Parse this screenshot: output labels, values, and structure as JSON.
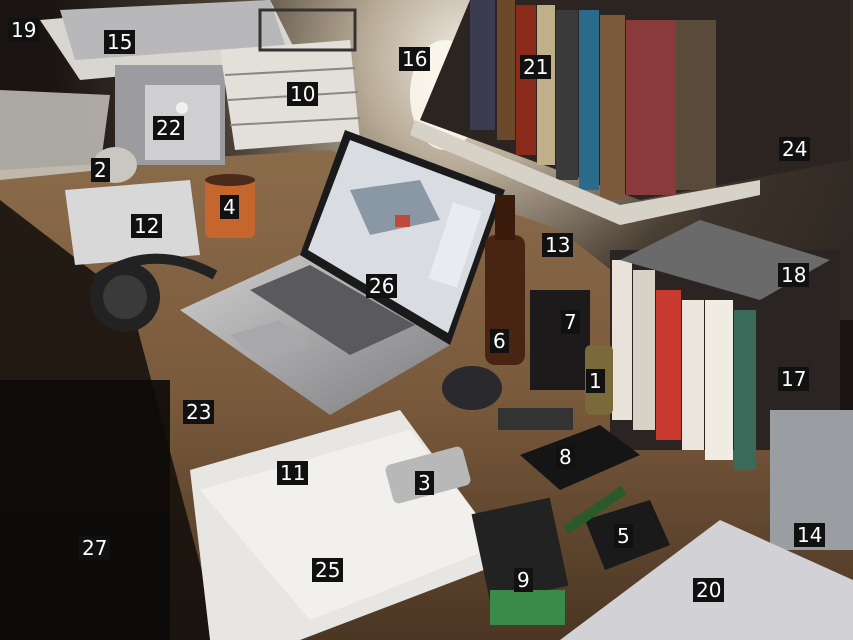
{
  "labels": [
    {
      "id": "l1",
      "text": "1"
    },
    {
      "id": "l2",
      "text": "2"
    },
    {
      "id": "l3",
      "text": "3"
    },
    {
      "id": "l4",
      "text": "4"
    },
    {
      "id": "l5",
      "text": "5"
    },
    {
      "id": "l6",
      "text": "6"
    },
    {
      "id": "l7",
      "text": "7"
    },
    {
      "id": "l8",
      "text": "8"
    },
    {
      "id": "l9",
      "text": "9"
    },
    {
      "id": "l10",
      "text": "10"
    },
    {
      "id": "l11",
      "text": "11"
    },
    {
      "id": "l12",
      "text": "12"
    },
    {
      "id": "l13",
      "text": "13"
    },
    {
      "id": "l14",
      "text": "14"
    },
    {
      "id": "l15",
      "text": "15"
    },
    {
      "id": "l16",
      "text": "16"
    },
    {
      "id": "l17",
      "text": "17"
    },
    {
      "id": "l18",
      "text": "18"
    },
    {
      "id": "l19",
      "text": "19"
    },
    {
      "id": "l20",
      "text": "20"
    },
    {
      "id": "l21",
      "text": "21"
    },
    {
      "id": "l22",
      "text": "22"
    },
    {
      "id": "l23",
      "text": "23"
    },
    {
      "id": "l24",
      "text": "24"
    },
    {
      "id": "l25",
      "text": "25"
    },
    {
      "id": "l26",
      "text": "26"
    },
    {
      "id": "l27",
      "text": "27"
    }
  ]
}
